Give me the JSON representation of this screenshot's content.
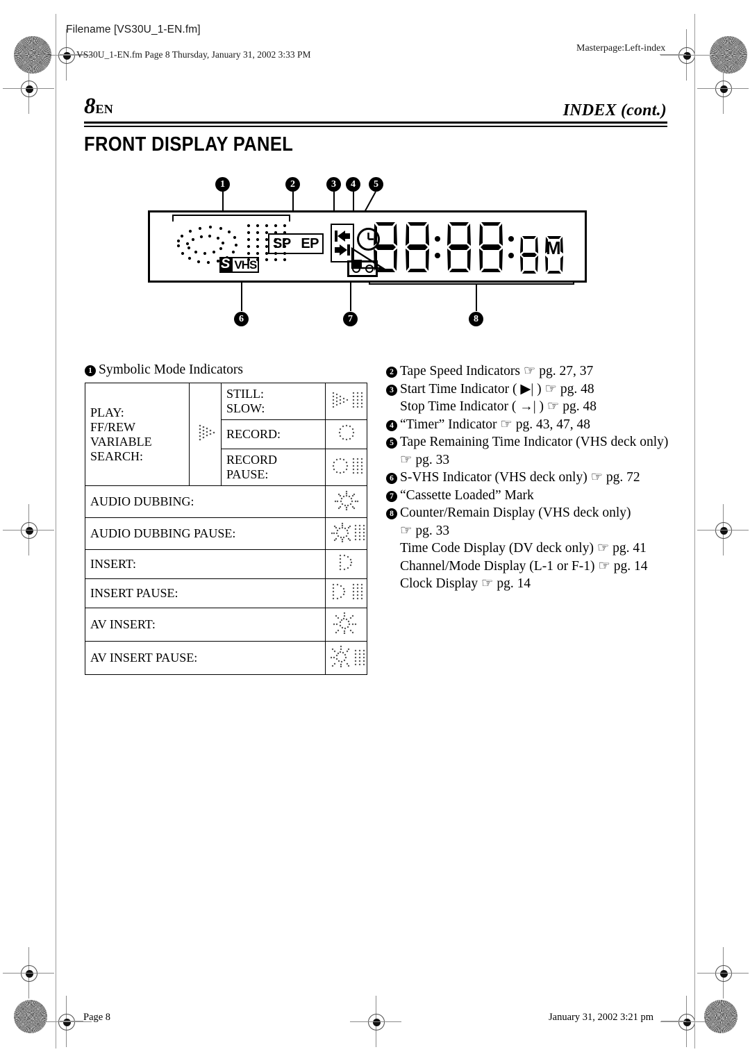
{
  "print_header": {
    "filename_label": "Filename [VS30U_1-EN.fm]",
    "fm_info": "VS30U_1-EN.fm  Page 8  Thursday, January 31, 2002  3:33 PM",
    "masterpage": "Masterpage:Left-index"
  },
  "page": {
    "number": "8",
    "locale": "EN",
    "running_head": "INDEX (cont.)",
    "section_title": "FRONT DISPLAY PANEL"
  },
  "lcd": {
    "tape_speed_sp": "SP",
    "tape_speed_ep": "EP",
    "svhs_s": "S",
    "svhs_vhs": "VHS",
    "segment_display": "88:88:88",
    "segment_m": "M",
    "callouts": [
      "1",
      "2",
      "3",
      "4",
      "5",
      "6",
      "7",
      "8"
    ]
  },
  "left_column": {
    "heading_marker": "1",
    "heading": "Symbolic Mode Indicators",
    "table": {
      "group_label": "PLAY:\nFF/REW VARIABLE\nSEARCH:",
      "group_label_lines": [
        "PLAY:",
        "FF/REW VARIABLE",
        "SEARCH:"
      ],
      "group_icon": "play-triangle-dotted-icon",
      "sub_rows": [
        {
          "label_lines": [
            "STILL:",
            "SLOW:"
          ],
          "icon": "play-pause-dotted-icon"
        },
        {
          "label_lines": [
            "RECORD:"
          ],
          "icon": "record-circle-dotted-icon"
        },
        {
          "label_lines": [
            "RECORD PAUSE:"
          ],
          "icon": "record-pause-dotted-icon"
        }
      ],
      "rows": [
        {
          "label": "AUDIO DUBBING:",
          "icon": "audio-dub-star-dotted-icon"
        },
        {
          "label": "AUDIO DUBBING PAUSE:",
          "icon": "audio-dub-pause-dotted-icon"
        },
        {
          "label": "INSERT:",
          "icon": "insert-c-dotted-icon"
        },
        {
          "label": "INSERT PAUSE:",
          "icon": "insert-pause-dotted-icon"
        },
        {
          "label": "AV INSERT:",
          "icon": "av-insert-star-dotted-icon"
        },
        {
          "label": "AV INSERT PAUSE:",
          "icon": "av-insert-pause-dotted-icon"
        }
      ]
    }
  },
  "right_column": {
    "items": [
      {
        "marker": "2",
        "lines": [
          "Tape Speed Indicators ☞ pg. 27, 37"
        ]
      },
      {
        "marker": "3",
        "lines": [
          "Start Time Indicator ( ▶| ) ☞ pg. 48",
          "Stop Time Indicator ( →| ) ☞ pg. 48"
        ]
      },
      {
        "marker": "4",
        "lines": [
          "“Timer” Indicator ☞ pg. 43, 47, 48"
        ]
      },
      {
        "marker": "5",
        "lines": [
          "Tape Remaining Time Indicator (VHS deck only)",
          "☞ pg. 33"
        ]
      },
      {
        "marker": "6",
        "lines": [
          "S-VHS Indicator (VHS deck only) ☞ pg. 72"
        ]
      },
      {
        "marker": "7",
        "lines": [
          "“Cassette Loaded” Mark"
        ]
      },
      {
        "marker": "8",
        "lines": [
          "Counter/Remain Display (VHS deck only)",
          "☞ pg. 33",
          "Time Code Display (DV deck only) ☞ pg. 41",
          "Channel/Mode Display (L-1 or F-1) ☞ pg. 14",
          "Clock Display ☞ pg. 14"
        ]
      }
    ]
  },
  "footer": {
    "left": "Page 8",
    "right": "January 31, 2002 3:21 pm"
  }
}
